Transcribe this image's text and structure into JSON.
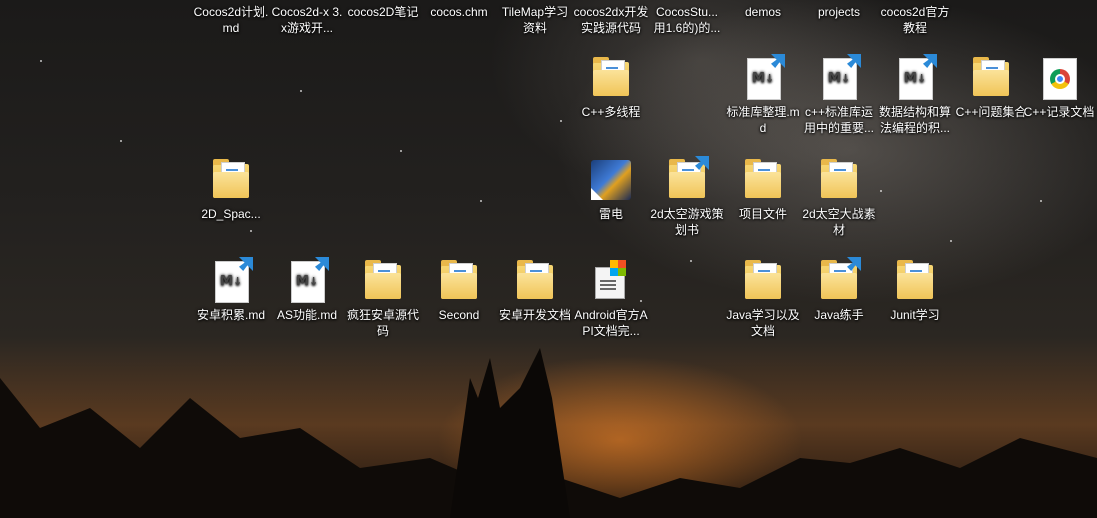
{
  "desktop": {
    "icons": [
      {
        "label": "Cocos2d计划.md",
        "type": "none"
      },
      {
        "label": "Cocos2d-x 3.x游戏开...",
        "type": "none"
      },
      {
        "label": "cocos2D笔记",
        "type": "none"
      },
      {
        "label": "cocos.chm",
        "type": "none"
      },
      {
        "label": "TileMap学习资料",
        "type": "none"
      },
      {
        "label": "cocos2dx开发实践源代码",
        "type": "none"
      },
      {
        "label": "CocosStu... 用1.6的)的...",
        "type": "none"
      },
      {
        "label": "demos",
        "type": "none"
      },
      {
        "label": "projects",
        "type": "none"
      },
      {
        "label": "cocos2d官方教程",
        "type": "none"
      },
      {
        "label": "C++多线程",
        "type": "folder"
      },
      {
        "label": "标准库整理.md",
        "type": "md"
      },
      {
        "label": "c++标准库运用中的重要...",
        "type": "md"
      },
      {
        "label": "数据结构和算法编程的积...",
        "type": "md"
      },
      {
        "label": "C++问题集合",
        "type": "folder"
      },
      {
        "label": "C++记录文档",
        "type": "chrome"
      },
      {
        "label": "2D_Spac...",
        "type": "folder"
      },
      {
        "label": "雷电",
        "type": "game"
      },
      {
        "label": "2d太空游戏策划书",
        "type": "folder"
      },
      {
        "label": "项目文件",
        "type": "folder"
      },
      {
        "label": "2d太空大战素材",
        "type": "folder"
      },
      {
        "label": "安卓积累.md",
        "type": "md"
      },
      {
        "label": "AS功能.md",
        "type": "md"
      },
      {
        "label": "疯狂安卓源代码",
        "type": "folder"
      },
      {
        "label": "Second",
        "type": "folder"
      },
      {
        "label": "安卓开发文档",
        "type": "folder"
      },
      {
        "label": "Android官方API文档完...",
        "type": "setup"
      },
      {
        "label": "Java学习以及文档",
        "type": "folder"
      },
      {
        "label": "Java练手",
        "type": "folder"
      },
      {
        "label": "Junit学习",
        "type": "folder"
      }
    ]
  },
  "icon_names": {
    "folder": "folder-icon",
    "md": "markdown-file-icon",
    "chrome": "chrome-document-icon",
    "game": "game-shortcut-icon",
    "setup": "installer-document-icon"
  },
  "colors": {
    "label": "#ffffff",
    "folder": "#f0c457",
    "badge": "#2b8ad8"
  }
}
